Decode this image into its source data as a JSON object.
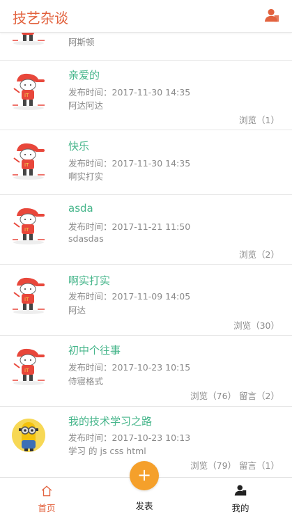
{
  "header": {
    "title": "技艺杂谈",
    "user_icon": "user-icon"
  },
  "posts": [
    {
      "title": "",
      "time": "",
      "summary": "阿斯顿",
      "stats": "",
      "avatar": "cartoon-boy-avatar"
    },
    {
      "title": "亲爱的",
      "time": "发布时间：2017-11-30 14:35",
      "summary": "阿达阿达",
      "stats": "浏览（1）",
      "avatar": "cartoon-boy-avatar"
    },
    {
      "title": "快乐",
      "time": "发布时间：2017-11-30 14:35",
      "summary": "啊实打实",
      "stats": "",
      "avatar": "cartoon-boy-avatar"
    },
    {
      "title": "asda",
      "time": "发布时间：2017-11-21 11:50",
      "summary": "sdasdas",
      "stats": "浏览（2）",
      "avatar": "cartoon-boy-avatar"
    },
    {
      "title": "啊实打实",
      "time": "发布时间：2017-11-09 14:05",
      "summary": "阿达",
      "stats": "浏览（30）",
      "avatar": "cartoon-boy-avatar"
    },
    {
      "title": "初中个往事",
      "time": "发布时间：2017-10-23 10:15",
      "summary": "侍寝格式",
      "stats": "浏览（76） 留言（2）",
      "avatar": "cartoon-boy-avatar"
    },
    {
      "title": "我的技术学习之路",
      "time": "发布时间：2017-10-23 10:13",
      "summary": "学习 的 js css html",
      "stats": "浏览（79） 留言（1）",
      "avatar": "minion-avatar"
    }
  ],
  "tabbar": {
    "home": {
      "label": "首页",
      "icon": "home-icon"
    },
    "publish": {
      "label": "发表",
      "symbol": "+",
      "icon": "plus-icon"
    },
    "mine": {
      "label": "我的",
      "icon": "user-icon"
    }
  },
  "colors": {
    "accent": "#e2623e",
    "title_green": "#45b58a",
    "fab_orange": "#f5a02b"
  }
}
